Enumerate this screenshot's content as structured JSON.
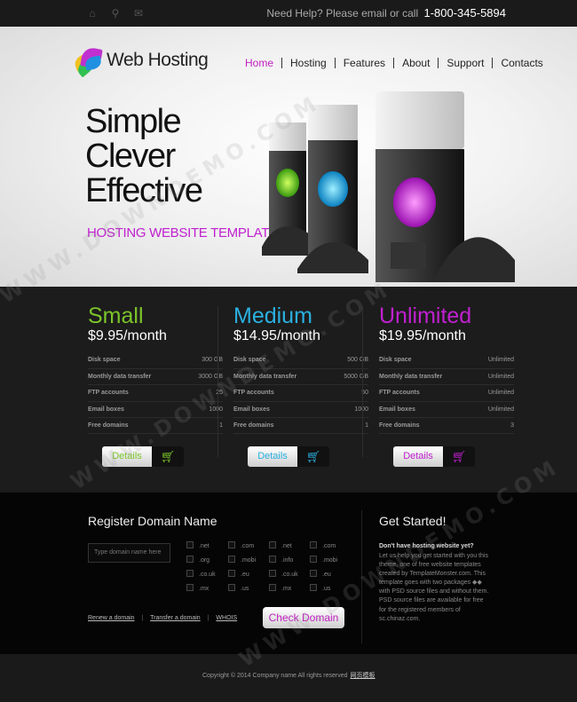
{
  "topbar": {
    "icons": [
      "home-icon",
      "sitemap-icon",
      "mail-icon"
    ],
    "help_text": "Need Help? Please email or call",
    "phone": "1-800-345-5894"
  },
  "header": {
    "logo_text": "Web Hosting",
    "nav": [
      "Home",
      "Hosting",
      "Features",
      "About",
      "Support",
      "Contacts"
    ],
    "active_nav": "Home",
    "hero_lines": [
      "Simple",
      "Clever",
      "Effective"
    ],
    "hero_subtitle": "HOSTING WEBSITE TEMPLATE"
  },
  "plans": [
    {
      "name": "Small",
      "price": "$9.95/month",
      "color": "#7cc52a",
      "rows": [
        [
          "Disk space",
          "300 GB"
        ],
        [
          "Monthly data transfer",
          "3000 GB"
        ],
        [
          "FTP accounts",
          "25"
        ],
        [
          "Email boxes",
          "1000"
        ],
        [
          "Free domains",
          "1"
        ]
      ],
      "details_label": "Details"
    },
    {
      "name": "Medium",
      "price": "$14.95/month",
      "color": "#2ab0e0",
      "rows": [
        [
          "Disk space",
          "500 GB"
        ],
        [
          "Monthly data transfer",
          "5000 GB"
        ],
        [
          "FTP accounts",
          "50"
        ],
        [
          "Email boxes",
          "1000"
        ],
        [
          "Free domains",
          "1"
        ]
      ],
      "details_label": "Details"
    },
    {
      "name": "Unlimited",
      "price": "$19.95/month",
      "color": "#c020d0",
      "rows": [
        [
          "Disk space",
          "Unlimited"
        ],
        [
          "Monthly data transfer",
          "Unlimited"
        ],
        [
          "FTP accounts",
          "Unlimited"
        ],
        [
          "Email boxes",
          "Unlimited"
        ],
        [
          "Free domains",
          "3"
        ]
      ],
      "details_label": "Details"
    }
  ],
  "domain": {
    "title": "Register Domain Name",
    "placeholder": "Type domain name here",
    "tlds": [
      [
        ".net",
        ".com",
        ".net",
        ".com"
      ],
      [
        ".org",
        ".mobi",
        ".info",
        ".mobi"
      ],
      [
        ".co.uk",
        ".eu",
        ".co.uk",
        ".eu"
      ],
      [
        ".mx",
        ".us",
        ".mx",
        ".us"
      ]
    ],
    "links": [
      "Renew a domain",
      "Transfer a domain",
      "WHOIS"
    ],
    "check_label": "Check Domain"
  },
  "get_started": {
    "title": "Get Started!",
    "subtitle": "Don't have hosting website yet?",
    "text": "Let us help you get started with you this theme, one of free website templates created by TemplateMonster.com. This template goes with two packages ◆◆ with PSD source files and without them. PSD source files are available for free for the registered members of sc.chinaz.com."
  },
  "footer": {
    "copyright": "Copyright © 2014 Company name All rights reserved",
    "link": "网页模板"
  },
  "watermark": "WWW.DOWNDEMO.COM"
}
